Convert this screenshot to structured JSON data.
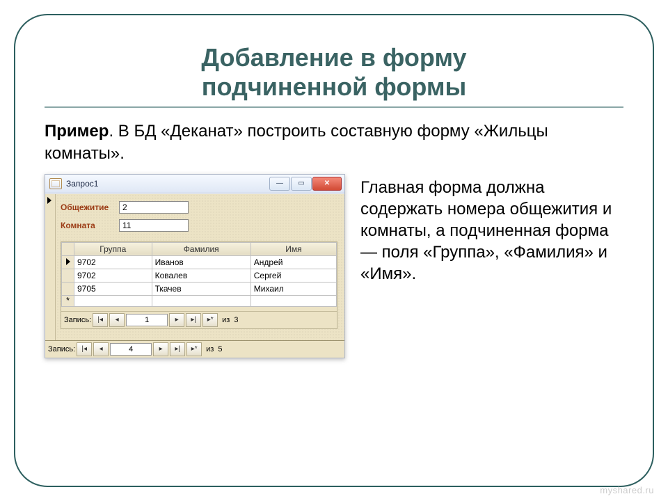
{
  "slide": {
    "title_line1": "Добавление в форму",
    "title_line2": "подчиненной формы",
    "prompt_bold": "Пример",
    "prompt_rest": ". В БД «Деканат» построить составную форму «Жильцы комнаты».",
    "description": "Главная форма должна содержать номера общежития и комнаты, а подчиненная форма — поля  «Группа», «Фамилия» и «Имя»."
  },
  "window": {
    "title": "Запрос1"
  },
  "main_form": {
    "fields": {
      "dorm": {
        "label": "Общежитие",
        "value": "2"
      },
      "room": {
        "label": "Комната",
        "value": "11"
      }
    }
  },
  "subform": {
    "headers": {
      "group": "Группа",
      "surname": "Фамилия",
      "name": "Имя"
    },
    "rows": [
      {
        "group": "9702",
        "surname": "Иванов",
        "name": "Андрей"
      },
      {
        "group": "9702",
        "surname": "Ковалев",
        "name": "Сергей"
      },
      {
        "group": "9705",
        "surname": "Ткачев",
        "name": "Михаил"
      }
    ]
  },
  "nav": {
    "label": "Запись:",
    "inner": {
      "current": "1",
      "of_label": "из",
      "total": "3"
    },
    "outer": {
      "current": "4",
      "of_label": "из",
      "total": "5"
    }
  },
  "watermark": "myshared.ru"
}
